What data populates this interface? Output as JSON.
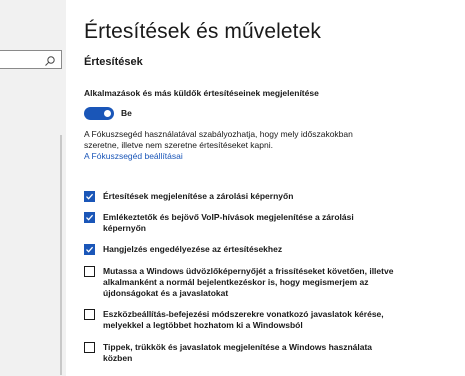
{
  "search": {
    "placeholder": ""
  },
  "page": {
    "title": "Értesítések és műveletek"
  },
  "notifications": {
    "section_title": "Értesítések",
    "toggle_label": "Alkalmazások és más küldők értesítéseinek megjelenítése",
    "toggle_state_label": "Be",
    "toggle_on": true,
    "focus_description": "A Fókuszsegéd használatával szabályozhatja, hogy mely időszakokban szeretne, illetve nem szeretne értesítéseket kapni.",
    "focus_link": "A Fókuszsegéd beállításai",
    "options": [
      {
        "label": "Értesítések megjelenítése a zárolási képernyőn",
        "checked": true
      },
      {
        "label": "Emlékeztetők és bejövő VoIP-hívások megjelenítése a zárolási képernyőn",
        "checked": true
      },
      {
        "label": "Hangjelzés engedélyezése az értesítésekhez",
        "checked": true
      },
      {
        "label": "Mutassa a Windows üdvözlőképernyőjét a frissítéseket követően, illetve alkalmanként a normál bejelentkezéskor is, hogy megismerjem az újdonságokat és a javaslatokat",
        "checked": false
      },
      {
        "label": "Eszközbeállítás-befejezési módszerekre vonatkozó javaslatok kérése, melyekkel a legtöbbet hozhatom ki a Windowsból",
        "checked": false
      },
      {
        "label": "Tippek, trükkök és javaslatok megjelenítése a Windows használata közben",
        "checked": false
      }
    ]
  },
  "colors": {
    "accent": "#1a56b8",
    "sidebar_bg": "#f1f1f1"
  }
}
